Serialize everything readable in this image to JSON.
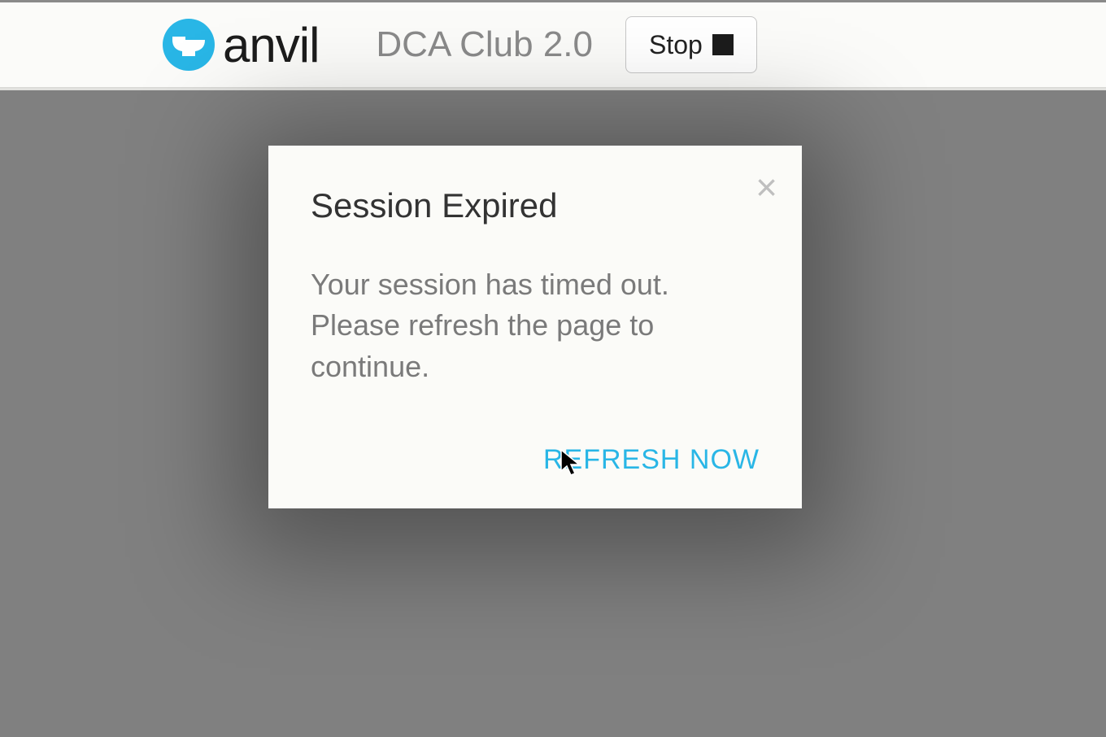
{
  "header": {
    "logo_text": "anvil",
    "app_name": "DCA Club 2.0",
    "stop_label": "Stop"
  },
  "modal": {
    "title": "Session Expired",
    "body": "Your session has timed out. Please refresh the page to continue.",
    "refresh_label": "REFRESH NOW",
    "close_glyph": "×"
  },
  "colors": {
    "accent": "#29b6e6",
    "backdrop": "#808080",
    "modal_bg": "#fbfbf8"
  }
}
